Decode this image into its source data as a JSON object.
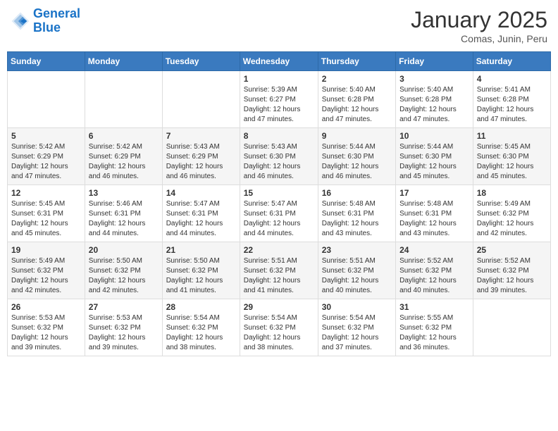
{
  "header": {
    "logo_line1": "General",
    "logo_line2": "Blue",
    "title": "January 2025",
    "subtitle": "Comas, Junin, Peru"
  },
  "calendar": {
    "days_of_week": [
      "Sunday",
      "Monday",
      "Tuesday",
      "Wednesday",
      "Thursday",
      "Friday",
      "Saturday"
    ],
    "weeks": [
      [
        {
          "day": "",
          "info": ""
        },
        {
          "day": "",
          "info": ""
        },
        {
          "day": "",
          "info": ""
        },
        {
          "day": "1",
          "info": "Sunrise: 5:39 AM\nSunset: 6:27 PM\nDaylight: 12 hours and 47 minutes."
        },
        {
          "day": "2",
          "info": "Sunrise: 5:40 AM\nSunset: 6:28 PM\nDaylight: 12 hours and 47 minutes."
        },
        {
          "day": "3",
          "info": "Sunrise: 5:40 AM\nSunset: 6:28 PM\nDaylight: 12 hours and 47 minutes."
        },
        {
          "day": "4",
          "info": "Sunrise: 5:41 AM\nSunset: 6:28 PM\nDaylight: 12 hours and 47 minutes."
        }
      ],
      [
        {
          "day": "5",
          "info": "Sunrise: 5:42 AM\nSunset: 6:29 PM\nDaylight: 12 hours and 47 minutes."
        },
        {
          "day": "6",
          "info": "Sunrise: 5:42 AM\nSunset: 6:29 PM\nDaylight: 12 hours and 46 minutes."
        },
        {
          "day": "7",
          "info": "Sunrise: 5:43 AM\nSunset: 6:29 PM\nDaylight: 12 hours and 46 minutes."
        },
        {
          "day": "8",
          "info": "Sunrise: 5:43 AM\nSunset: 6:30 PM\nDaylight: 12 hours and 46 minutes."
        },
        {
          "day": "9",
          "info": "Sunrise: 5:44 AM\nSunset: 6:30 PM\nDaylight: 12 hours and 46 minutes."
        },
        {
          "day": "10",
          "info": "Sunrise: 5:44 AM\nSunset: 6:30 PM\nDaylight: 12 hours and 45 minutes."
        },
        {
          "day": "11",
          "info": "Sunrise: 5:45 AM\nSunset: 6:30 PM\nDaylight: 12 hours and 45 minutes."
        }
      ],
      [
        {
          "day": "12",
          "info": "Sunrise: 5:45 AM\nSunset: 6:31 PM\nDaylight: 12 hours and 45 minutes."
        },
        {
          "day": "13",
          "info": "Sunrise: 5:46 AM\nSunset: 6:31 PM\nDaylight: 12 hours and 44 minutes."
        },
        {
          "day": "14",
          "info": "Sunrise: 5:47 AM\nSunset: 6:31 PM\nDaylight: 12 hours and 44 minutes."
        },
        {
          "day": "15",
          "info": "Sunrise: 5:47 AM\nSunset: 6:31 PM\nDaylight: 12 hours and 44 minutes."
        },
        {
          "day": "16",
          "info": "Sunrise: 5:48 AM\nSunset: 6:31 PM\nDaylight: 12 hours and 43 minutes."
        },
        {
          "day": "17",
          "info": "Sunrise: 5:48 AM\nSunset: 6:31 PM\nDaylight: 12 hours and 43 minutes."
        },
        {
          "day": "18",
          "info": "Sunrise: 5:49 AM\nSunset: 6:32 PM\nDaylight: 12 hours and 42 minutes."
        }
      ],
      [
        {
          "day": "19",
          "info": "Sunrise: 5:49 AM\nSunset: 6:32 PM\nDaylight: 12 hours and 42 minutes."
        },
        {
          "day": "20",
          "info": "Sunrise: 5:50 AM\nSunset: 6:32 PM\nDaylight: 12 hours and 42 minutes."
        },
        {
          "day": "21",
          "info": "Sunrise: 5:50 AM\nSunset: 6:32 PM\nDaylight: 12 hours and 41 minutes."
        },
        {
          "day": "22",
          "info": "Sunrise: 5:51 AM\nSunset: 6:32 PM\nDaylight: 12 hours and 41 minutes."
        },
        {
          "day": "23",
          "info": "Sunrise: 5:51 AM\nSunset: 6:32 PM\nDaylight: 12 hours and 40 minutes."
        },
        {
          "day": "24",
          "info": "Sunrise: 5:52 AM\nSunset: 6:32 PM\nDaylight: 12 hours and 40 minutes."
        },
        {
          "day": "25",
          "info": "Sunrise: 5:52 AM\nSunset: 6:32 PM\nDaylight: 12 hours and 39 minutes."
        }
      ],
      [
        {
          "day": "26",
          "info": "Sunrise: 5:53 AM\nSunset: 6:32 PM\nDaylight: 12 hours and 39 minutes."
        },
        {
          "day": "27",
          "info": "Sunrise: 5:53 AM\nSunset: 6:32 PM\nDaylight: 12 hours and 39 minutes."
        },
        {
          "day": "28",
          "info": "Sunrise: 5:54 AM\nSunset: 6:32 PM\nDaylight: 12 hours and 38 minutes."
        },
        {
          "day": "29",
          "info": "Sunrise: 5:54 AM\nSunset: 6:32 PM\nDaylight: 12 hours and 38 minutes."
        },
        {
          "day": "30",
          "info": "Sunrise: 5:54 AM\nSunset: 6:32 PM\nDaylight: 12 hours and 37 minutes."
        },
        {
          "day": "31",
          "info": "Sunrise: 5:55 AM\nSunset: 6:32 PM\nDaylight: 12 hours and 36 minutes."
        },
        {
          "day": "",
          "info": ""
        }
      ]
    ]
  }
}
